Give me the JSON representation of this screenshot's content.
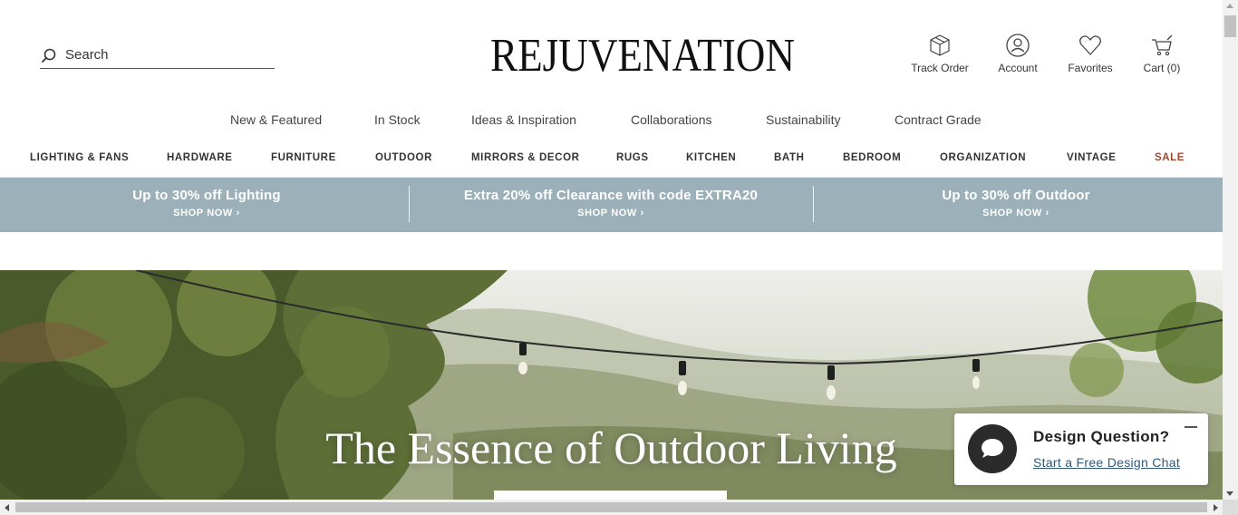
{
  "header": {
    "search_placeholder": "Search",
    "logo_text": "REJUVENATION",
    "utilities": [
      {
        "label": "Track Order",
        "icon": "box-icon"
      },
      {
        "label": "Account",
        "icon": "user-icon"
      },
      {
        "label": "Favorites",
        "icon": "heart-icon"
      },
      {
        "label": "Cart (0)",
        "icon": "cart-icon"
      }
    ]
  },
  "subnav": [
    "New & Featured",
    "In Stock",
    "Ideas & Inspiration",
    "Collaborations",
    "Sustainability",
    "Contract Grade"
  ],
  "mainnav": [
    "LIGHTING & FANS",
    "HARDWARE",
    "FURNITURE",
    "OUTDOOR",
    "MIRRORS & DECOR",
    "RUGS",
    "KITCHEN",
    "BATH",
    "BEDROOM",
    "ORGANIZATION",
    "VINTAGE",
    "SALE"
  ],
  "promo": {
    "background": "#9bb0b8",
    "items": [
      {
        "title": "Up to 30% off Lighting",
        "cta": "SHOP NOW ›"
      },
      {
        "title": "Extra 20% off Clearance with code EXTRA20",
        "cta": "SHOP NOW ›"
      },
      {
        "title": "Up to 30% off Outdoor",
        "cta": "SHOP NOW ›"
      }
    ]
  },
  "hero": {
    "title": "The Essence of Outdoor Living"
  },
  "chat": {
    "title": "Design Question?",
    "link": "Start a Free Design Chat",
    "icon": "chat-bubble-icon"
  },
  "colors": {
    "sale": "#a0472e",
    "chat_link": "#2d5a7b"
  }
}
